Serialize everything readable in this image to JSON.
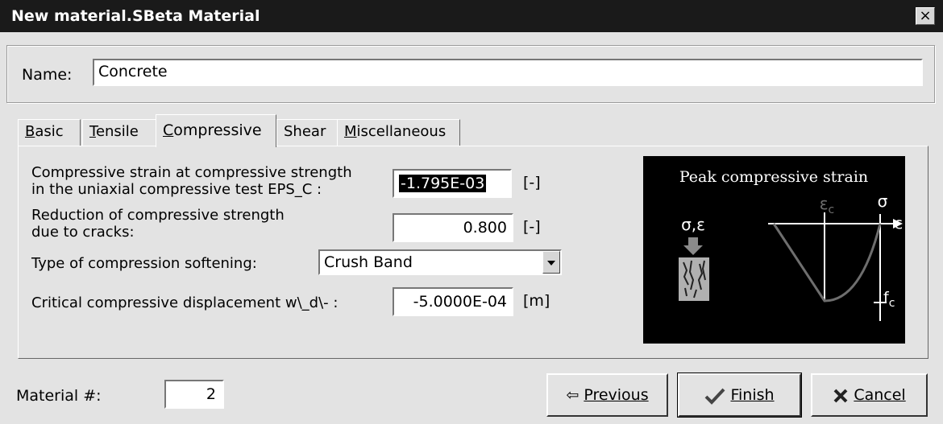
{
  "window": {
    "title": "New material.SBeta Material",
    "close_label": "×"
  },
  "name": {
    "label": "Name:",
    "value": "Concrete"
  },
  "tabs": [
    {
      "label": "Basic",
      "active": false
    },
    {
      "label": "Tensile",
      "active": false
    },
    {
      "label": "Compressive",
      "active": true
    },
    {
      "label": "Shear",
      "active": false
    },
    {
      "label": "Miscellaneous",
      "active": false
    }
  ],
  "fields": {
    "eps_c": {
      "label_line1": "Compressive strain at compressive strength",
      "label_line2": "in the uniaxial compressive test EPS_C :",
      "value": "-1.795E-03",
      "unit": "[-]"
    },
    "reduction": {
      "label_line1": "Reduction of compressive strength",
      "label_line2": "due to cracks:",
      "value": "0.800",
      "unit": "[-]"
    },
    "softening": {
      "label": "Type of compression softening:",
      "value": "Crush Band"
    },
    "wd": {
      "label": "Critical compressive displacement w\\_d\\- :",
      "value": "-5.0000E-04",
      "unit": "[m]"
    }
  },
  "diagram": {
    "title": "Peak compressive strain",
    "sigma_eps": "σ,ε",
    "eps_c": "ε",
    "eps_c_sub": "c",
    "sigma": "σ",
    "eps": "ε",
    "fc": "f",
    "fc_sub": "c"
  },
  "footer": {
    "material_label": "Material #:",
    "material_value": "2",
    "previous": "Previous",
    "finish": "Finish",
    "cancel": "Cancel"
  },
  "colors": {
    "accent": "#000000",
    "curve": "#6e6e6e"
  }
}
